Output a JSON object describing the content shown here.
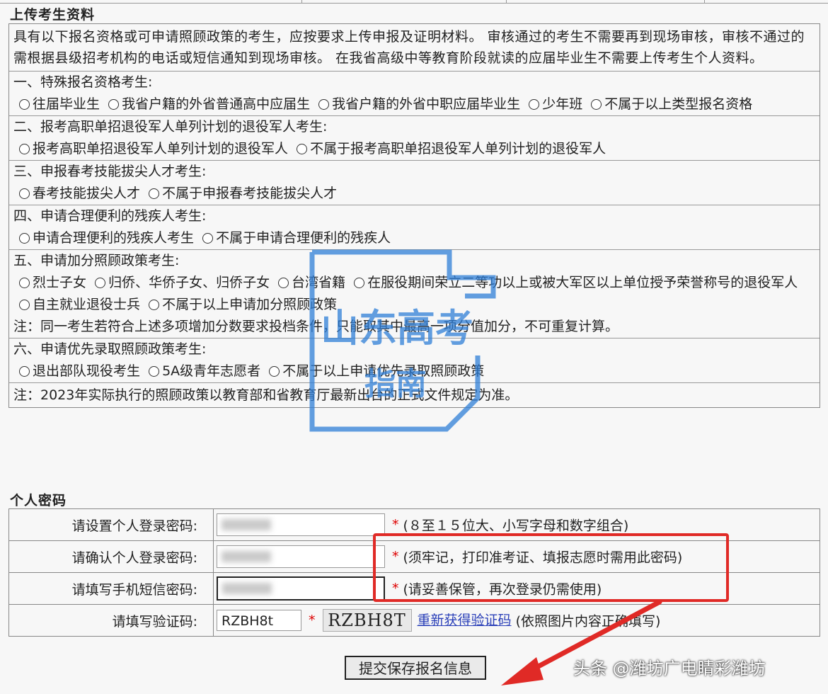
{
  "section_upload_title": "上传考生资料",
  "intro_text": "具有以下报名资格或可申请照顾政策的考生，应按要求上传申报及证明材料。 审核通过的考生不需要再到现场审核，审核不通过的需根据县级招考机构的电话或短信通知到现场审核。 在我省高级中等教育阶段就读的应届毕业生不需要上传考生个人资料。",
  "groups": [
    {
      "title": "一、特殊报名资格考生:",
      "options": [
        "往届毕业生",
        "我省户籍的外省普通高中应届生",
        "我省户籍的外省中职应届毕业生",
        "少年班",
        "不属于以上类型报名资格"
      ]
    },
    {
      "title": "二、报考高职单招退役军人单列计划的退役军人考生:",
      "options": [
        "报考高职单招退役军人单列计划的退役军人",
        "不属于报考高职单招退役军人单列计划的退役军人"
      ]
    },
    {
      "title": "三、申报春考技能拔尖人才考生:",
      "options": [
        "春考技能拔尖人才",
        "不属于申报春考技能拔尖人才"
      ]
    },
    {
      "title": "四、申请合理便利的残疾人考生:",
      "options": [
        "申请合理便利的残疾人考生",
        "不属于申请合理便利的残疾人"
      ]
    },
    {
      "title": "五、申请加分照顾政策考生:",
      "options": [
        "烈士子女",
        "归侨、华侨子女、归侨子女",
        "台湾省籍",
        "在服役期间荣立二等功以上或被大军区以上单位授予荣誉称号的退役军人",
        "自主就业退役士兵",
        "不属于以上申请加分照顾政策"
      ],
      "note": "注：同一考生若符合上述多项增加分数要求投档条件，只能取其中最高一项分值加分，不可重复计算。"
    },
    {
      "title": "六、申请优先录取照顾政策考生:",
      "options": [
        "退出部队现役考生",
        "5A级青年志愿者",
        "不属于以上申请优先录取照顾政策"
      ]
    }
  ],
  "final_note": "注：2023年实际执行的照顾政策以教育部和省教育厅最新出台的正式文件规定为准。",
  "section_password_title": "个人密码",
  "password_rows": [
    {
      "label": "请设置个人登录密码:",
      "hint": "(８至１５位大、小写字母和数字组合)"
    },
    {
      "label": "请确认个人登录密码:",
      "hint": "(须牢记，打印准考证、填报志愿时需用此密码)"
    },
    {
      "label": "请填写手机短信密码:",
      "hint": "(请妥善保管，再次登录仍需使用)"
    }
  ],
  "captcha_row": {
    "label": "请填写验证码:",
    "value": "RZBH8t",
    "image_text": "RZBH8T",
    "refresh_link": "重新获得验证码",
    "hint": "(依照图片内容正确填写)"
  },
  "required_mark": "*",
  "submit_label": "提交保存报名信息",
  "watermark": {
    "stamp_text_1": "山东高考",
    "stamp_text_2": "指南",
    "caption": "头条 @潍坊广电睛彩潍坊"
  },
  "colors": {
    "highlight_red": "#e02a26",
    "stamp_blue": "#2f7fd8",
    "link_blue": "#2a3fb8"
  }
}
